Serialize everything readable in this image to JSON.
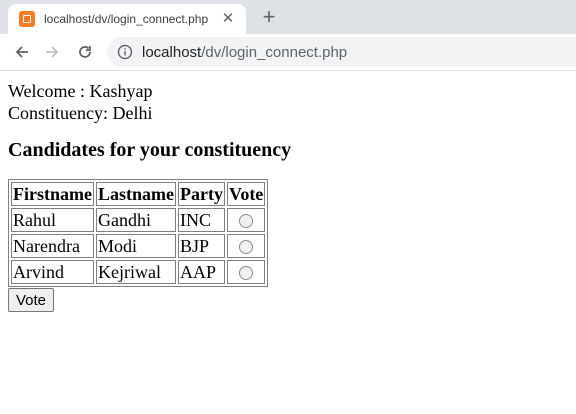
{
  "browser": {
    "tab_title": "localhost/dv/login_connect.php",
    "new_tab": "+",
    "close_tab": "✕",
    "url_host": "localhost",
    "url_path": "/dv/login_connect.php"
  },
  "page": {
    "welcome": "Welcome : Kashyap",
    "constituency": "Constituency: Delhi",
    "heading": "Candidates for your constituency",
    "table": {
      "headers": [
        "Firstname",
        "Lastname",
        "Party",
        "Vote"
      ],
      "rows": [
        {
          "first": "Rahul",
          "last": "Gandhi",
          "party": "INC"
        },
        {
          "first": "Narendra",
          "last": "Modi",
          "party": "BJP"
        },
        {
          "first": "Arvind",
          "last": "Kejriwal",
          "party": "AAP"
        }
      ]
    },
    "vote_button": "Vote"
  }
}
